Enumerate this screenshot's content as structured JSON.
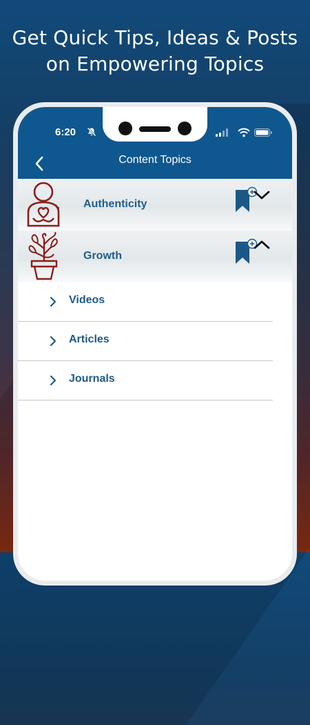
{
  "headline": {
    "line1": "Get Quick Tips, Ideas & Posts",
    "line2": "on Empowering Topics"
  },
  "status_bar": {
    "time": "6:20"
  },
  "appbar": {
    "title": "Content Topics"
  },
  "topics": [
    {
      "label": "Authenticity",
      "icon": "person-heart-icon",
      "expanded": false
    },
    {
      "label": "Growth",
      "icon": "plant-pot-icon",
      "expanded": true
    }
  ],
  "subitems": [
    {
      "label": "Videos"
    },
    {
      "label": "Articles"
    },
    {
      "label": "Journals"
    }
  ],
  "colors": {
    "appbar": "#0f578f",
    "icon_red": "#8b1e1a",
    "label_blue": "#1f5e8c",
    "bookmark_blue": "#1a5888"
  }
}
